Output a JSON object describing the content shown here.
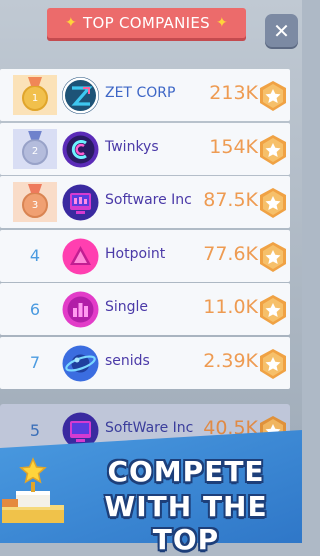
{
  "header": {
    "title": "TOP COMPANIES",
    "close_icon": "close-icon",
    "star_icon": "star-icon"
  },
  "rankings": [
    {
      "rank": "1",
      "medal": "gold",
      "name": "ZET CORP",
      "value": "213K",
      "logo": "zet-corp-logo"
    },
    {
      "rank": "2",
      "medal": "silver",
      "name": "Twinkys",
      "value": "154K",
      "logo": "twinkys-logo"
    },
    {
      "rank": "3",
      "medal": "bronze",
      "name": "Software Inc",
      "value": "87.5K",
      "logo": "software-inc-logo"
    },
    {
      "rank": "4",
      "medal": "",
      "name": "Hotpoint",
      "value": "77.6K",
      "logo": "hotpoint-logo"
    },
    {
      "rank": "6",
      "medal": "",
      "name": "Single",
      "value": "11.0K",
      "logo": "single-logo"
    },
    {
      "rank": "7",
      "medal": "",
      "name": "senids",
      "value": "2.39K",
      "logo": "senids-logo"
    }
  ],
  "pinned_row": {
    "rank": "5",
    "name": "SoftWare Inc",
    "value": "40.5K",
    "logo": "software-inc-logo"
  },
  "banner": {
    "line1": "COMPETE",
    "line2": "WITH THE TOP"
  },
  "colors": {
    "ribbon": "#ec6b6b",
    "value_text": "#ee9b52",
    "name_text": "#4b3aa8",
    "banner": "#3f8fd6"
  }
}
